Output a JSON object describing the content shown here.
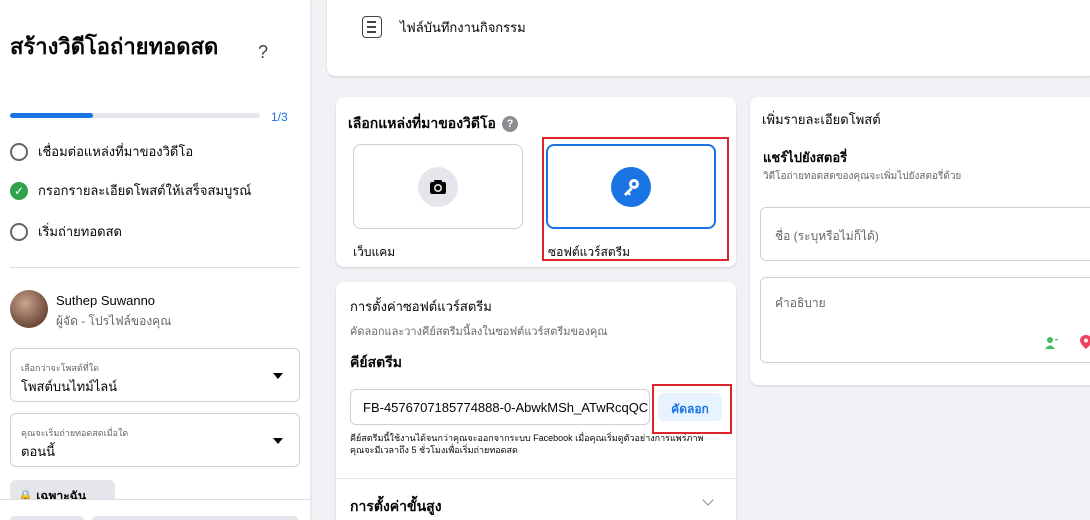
{
  "sidebar": {
    "title": "สร้างวิดีโอถ่ายทอดสด",
    "help_glyph": "?",
    "progress": {
      "text": "1/3",
      "fraction": 0.333
    },
    "steps": [
      {
        "label": "เชื่อมต่อแหล่งที่มาของวิดีโอ",
        "status": "pending"
      },
      {
        "label": "กรอกรายละเอียดโพสต์ให้เสร็จสมบูรณ์",
        "status": "done"
      },
      {
        "label": "เริ่มถ่ายทอดสด",
        "status": "pending"
      }
    ],
    "user": {
      "name": "Suthep Suwanno",
      "subtitle": "ผู้จัด - โปรไฟล์ของคุณ"
    },
    "post_location": {
      "label": "เลือกว่าจะโพสต์ที่ใด",
      "value": "โพสต์บนไทม์ไลน์"
    },
    "start_time": {
      "label": "คุณจะเริ่มถ่ายทอดสดเมื่อใด",
      "value": "ตอนนี้"
    },
    "privacy_label": "🔒 เฉพาะฉัน"
  },
  "top": {
    "activity_log": "ไฟล์บันทึกงานกิจกรรม"
  },
  "video_source": {
    "title": "เลือกแหล่งที่มาของวิดีโอ",
    "help_glyph": "?",
    "options": [
      {
        "label": "เว็บแคม",
        "icon": "camera-icon",
        "selected": false
      },
      {
        "label": "ซอฟต์แวร์สตรีม",
        "icon": "key-icon",
        "selected": true
      }
    ]
  },
  "software_settings": {
    "title": "การตั้งค่าซอฟต์แวร์สตรีม",
    "subtitle": "คัดลอกและวางคีย์สตรีมนี้ลงในซอฟต์แวร์สตรีมของคุณ",
    "key_label": "คีย์สตรีม",
    "stream_key": "FB-4576707185774888-0-AbwkMSh_ATwRcqQC",
    "copy_label": "คัดลอก",
    "note": "คีย์สตรีมนี้ใช้งานได้จนกว่าคุณจะออกจากระบบ Facebook เมื่อคุณเริ่มดูตัวอย่างการแพร่ภาพ คุณจะมีเวลาถึง 5 ชั่วโมงเพื่อเริ่มถ่ายทอดสด",
    "advanced_label": "การตั้งค่าขั้นสูง"
  },
  "post_details": {
    "title": "เพิ่มรายละเอียดโพสต์",
    "share_story_title": "แชร์ไปยังสตอรี่",
    "share_story_sub": "วิดีโอถ่ายทอดสดของคุณจะเพิ่มไปยังสตอรี่ด้วย",
    "title_placeholder": "ชื่อ (ระบุหรือไม่ก็ได้)",
    "description_placeholder": "คำอธิบาย"
  },
  "colors": {
    "accent": "#1b74e4",
    "success": "#31a24c",
    "highlight": "#e0242b"
  }
}
